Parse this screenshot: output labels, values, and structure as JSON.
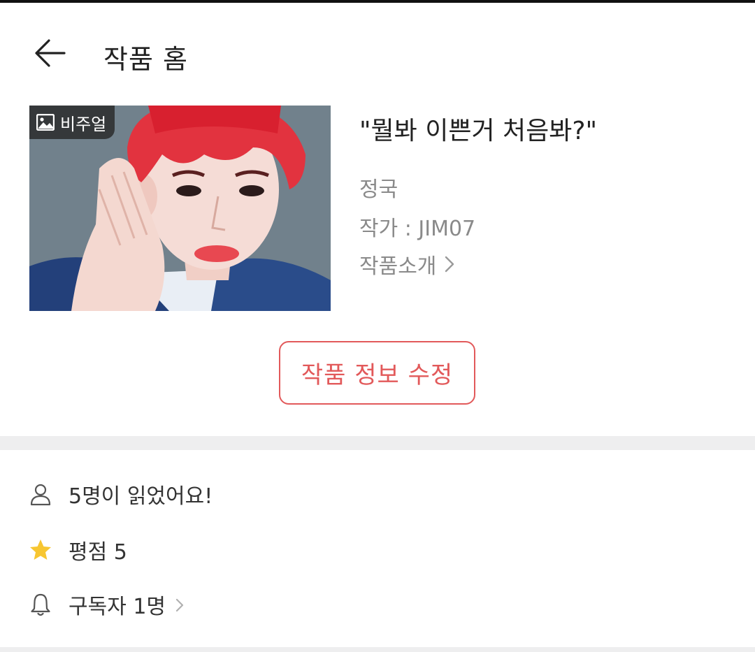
{
  "header": {
    "title": "작품 홈"
  },
  "work": {
    "badge_label": "비주얼",
    "title": "\"뭘봐 이쁜거 처음봐?\"",
    "character": "정국",
    "author": "작가 : JIM07",
    "intro_label": "작품소개",
    "edit_button_label": "작품 정보 수정"
  },
  "stats": {
    "readers": "5명이 읽었어요!",
    "rating": "평점 5",
    "subscribers": "구독자 1명"
  },
  "icons": {
    "back": "back-arrow-icon",
    "badge": "image-icon",
    "intro_chevron": "chevron-right-icon",
    "readers": "person-icon",
    "rating": "star-icon",
    "subscribers": "bell-icon"
  },
  "colors": {
    "accent": "#e2595a",
    "star": "#f7c631",
    "muted_text": "#8a8a8a",
    "divider": "#eeeeef"
  }
}
